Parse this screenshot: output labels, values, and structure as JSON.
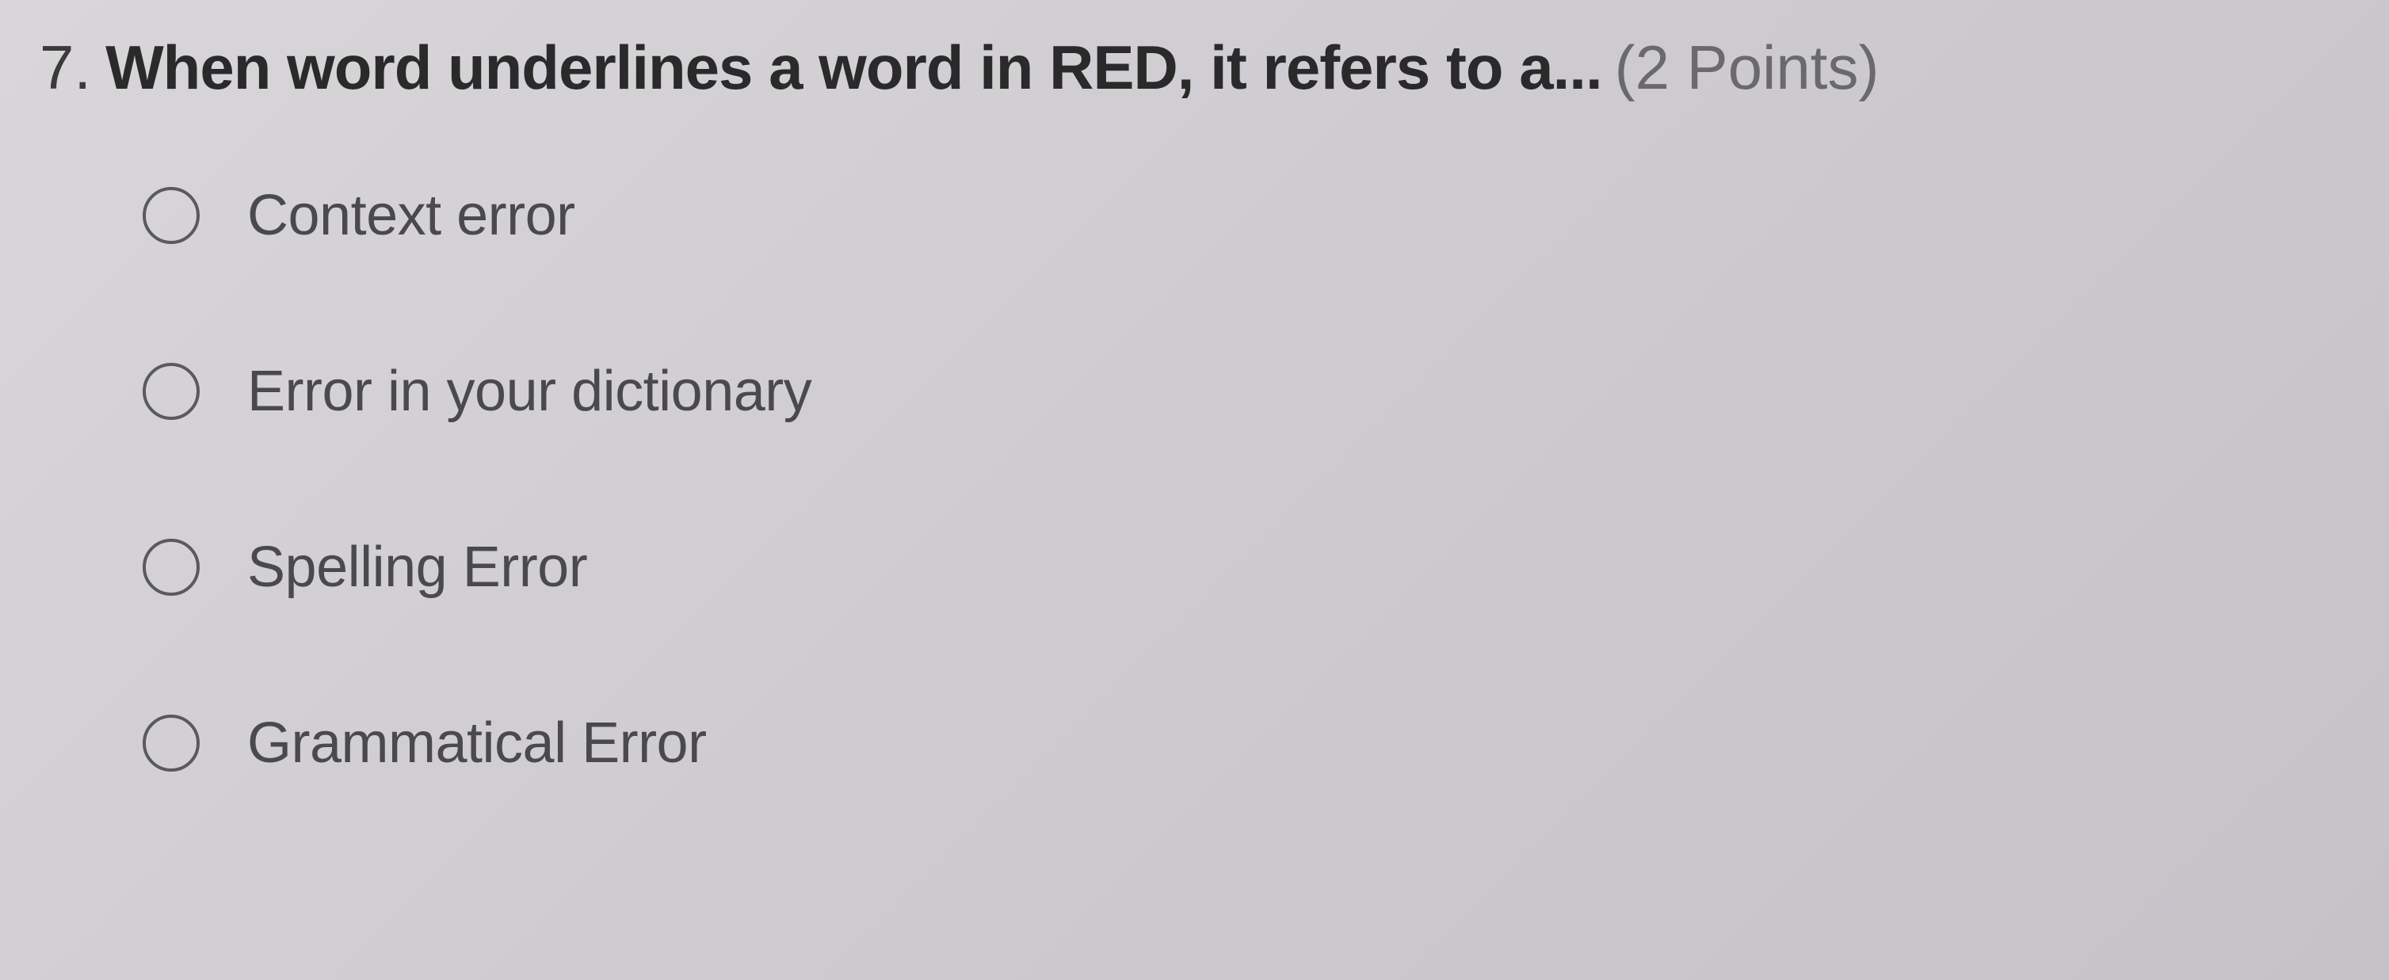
{
  "question": {
    "number": "7.",
    "text": "When word underlines a word in RED, it refers to a...",
    "points": "(2 Points)"
  },
  "options": [
    {
      "label": "Context error"
    },
    {
      "label": "Error in your dictionary"
    },
    {
      "label": "Spelling Error"
    },
    {
      "label": "Grammatical Error"
    }
  ]
}
